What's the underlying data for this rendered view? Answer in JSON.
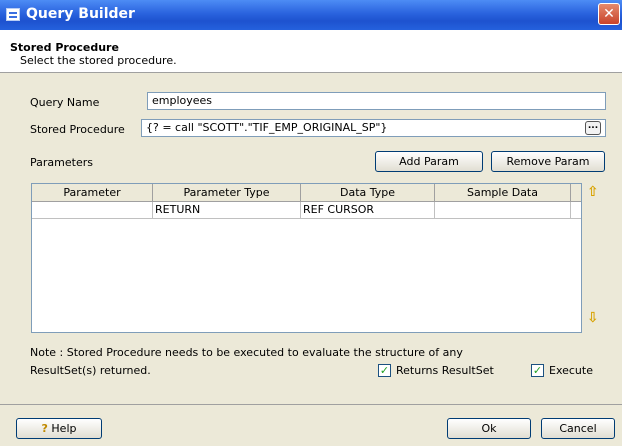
{
  "window": {
    "title": "Query Builder",
    "close_glyph": "✕"
  },
  "header": {
    "title": "Stored Procedure",
    "subtitle": "Select the stored procedure."
  },
  "form": {
    "query_name_label": "Query Name",
    "query_name_value": "employees",
    "stored_procedure_label": "Stored Procedure",
    "stored_procedure_value": "{? = call \"SCOTT\".\"TIF_EMP_ORIGINAL_SP\"}",
    "browse_glyph": "..."
  },
  "parameters": {
    "label": "Parameters",
    "add_button": "Add Param",
    "remove_button": "Remove Param",
    "columns": [
      "Parameter",
      "Parameter Type",
      "Data Type",
      "Sample Data"
    ],
    "rows": [
      [
        "",
        "RETURN",
        "REF CURSOR",
        ""
      ]
    ],
    "up_arrow": "⇧",
    "down_arrow": "⇩"
  },
  "note": {
    "line1": "Note : Stored Procedure needs to be executed to evaluate the structure of any",
    "line2": "ResultSet(s) returned."
  },
  "options": {
    "returns_resultset_label": "Returns ResultSet",
    "returns_resultset_checked": true,
    "execute_label": "Execute",
    "execute_checked": true,
    "check_glyph": "✓"
  },
  "footer": {
    "help_button": "Help",
    "help_icon": "?",
    "ok_button": "Ok",
    "cancel_button": "Cancel"
  }
}
